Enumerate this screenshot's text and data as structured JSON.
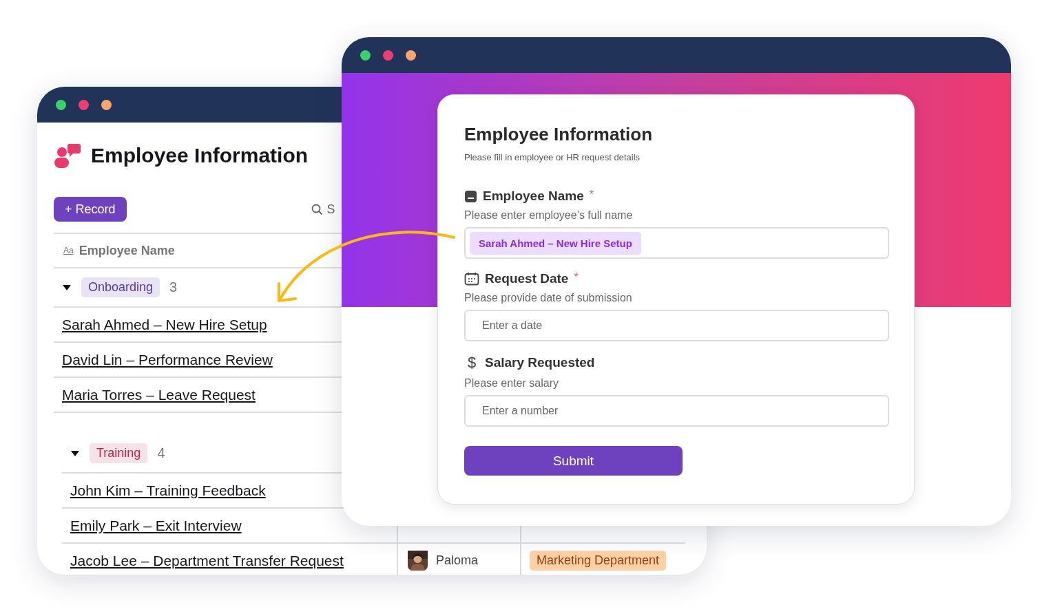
{
  "back_window": {
    "title": "Employee Information",
    "record_button": "+ Record",
    "search": {
      "placeholder": "S"
    },
    "column": {
      "icon_text": "Aa",
      "label": "Employee Name"
    },
    "groups": [
      {
        "tag": "Onboarding",
        "color": "#5b35b0",
        "count": "3",
        "expanded": true,
        "rows": [
          {
            "name": "Sarah Ahmed – New Hire Setup"
          },
          {
            "name": "David Lin – Performance Review"
          },
          {
            "name": "Maria Torres – Leave Request"
          }
        ]
      },
      {
        "tag": "Training",
        "color": "#c0254f",
        "count": "4",
        "expanded": true,
        "rows": [
          {
            "name": "John Kim – Training Feedback"
          },
          {
            "name": "Emily Park – Exit Interview"
          },
          {
            "name": "Jacob Lee – Department Transfer Request",
            "person": "Paloma",
            "tag": {
              "label": "Marketing Department",
              "color": "#fdd1a8"
            }
          }
        ]
      }
    ]
  },
  "form": {
    "title": "Employee Information",
    "subtitle": "Please fill in employee or HR request details",
    "fields": [
      {
        "kind": "text",
        "label": "Employee Name",
        "required_mark": "*",
        "description": "Please enter employee’s full name",
        "value": "Sarah Ahmed – New Hire Setup"
      },
      {
        "kind": "date",
        "label": "Request Date",
        "required_mark": "*",
        "description": "Please provide date of submission",
        "placeholder": "Enter a date"
      },
      {
        "kind": "number",
        "icon_text": "$",
        "label": "Salary Requested",
        "description": "Please enter salary",
        "placeholder": "Enter a number"
      }
    ],
    "submit": "Submit"
  }
}
